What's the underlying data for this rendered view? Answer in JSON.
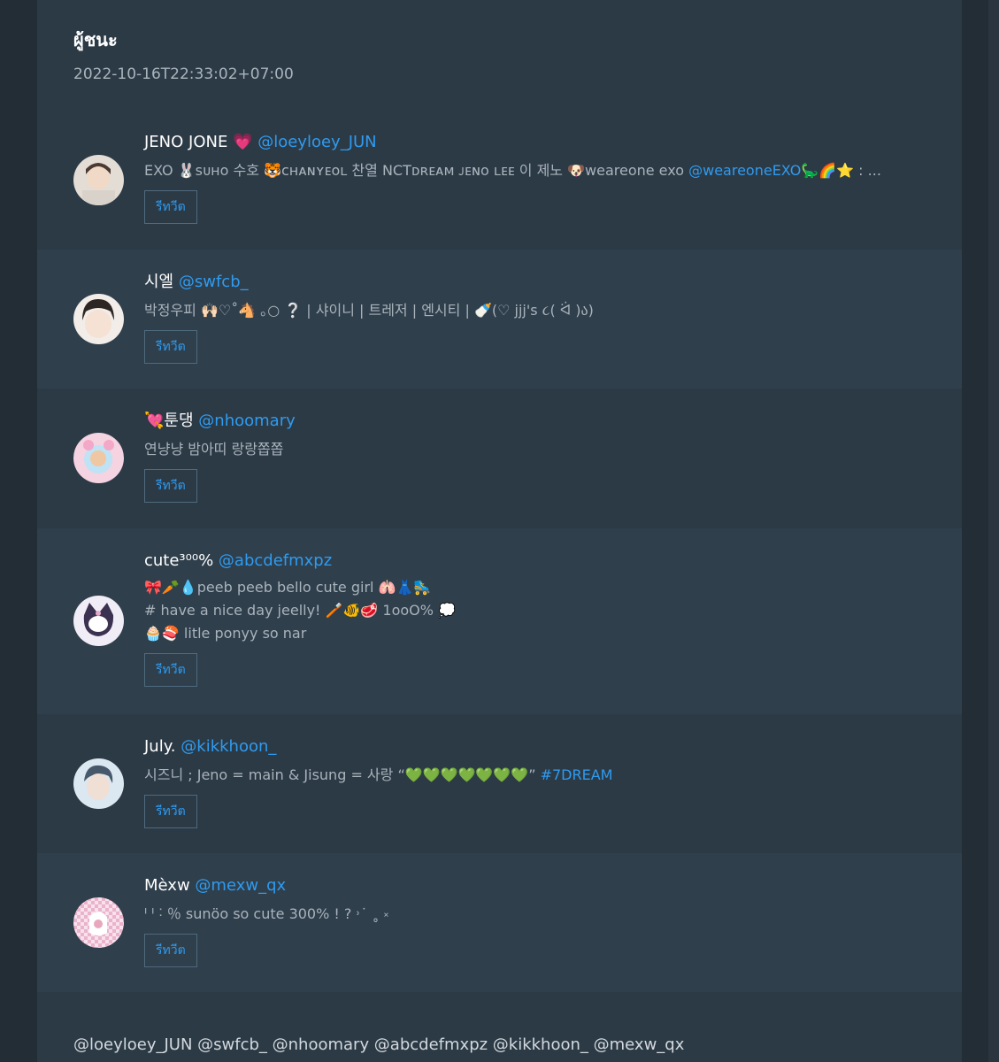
{
  "header": {
    "title": "ผู้ชนะ",
    "timestamp": "2022-10-16T22:33:02+07:00"
  },
  "retweet_label": "รีทวีต",
  "accounts": [
    {
      "name": "JENO JONE 💗",
      "handle": "@loeyloey_JUN",
      "bio_lines": [
        "EXO 🐰ꜱᴜʜᴏ 수호 🐯ᴄʜᴀɴʏᴇᴏʟ 찬열 NCTᴅʀᴇᴀᴍ ᴊᴇɴᴏ ʟᴇᴇ 이 제노 🐶weareone exo "
      ],
      "bio_link": "@weareoneEXO",
      "bio_tail": "🦕🌈⭐ : ...",
      "avatar_colors": [
        "#e6e0d8",
        "#6b5547"
      ]
    },
    {
      "name": "시엘",
      "handle": "@swfcb_",
      "bio_lines": [
        "박정우피 🙌🏻♡˚🐴 ｡○ ❔ | 샤이니 | 트레저 | 엔시티 | 🍼(♡ jjj's ૮( ᐛ )ა)"
      ],
      "avatar_colors": [
        "#f3eee9",
        "#3a2e2a"
      ]
    },
    {
      "name": "💘툰댕",
      "handle": "@nhoomary",
      "bio_lines": [
        "연냥냥 밤아띠 랑랑쫍쫍"
      ],
      "avatar_colors": [
        "#f4c6d8",
        "#b9e0f4"
      ]
    },
    {
      "name": "cute³⁰⁰%",
      "handle": "@abcdefmxpz",
      "bio_lines": [
        "🎀🥕💧peeb peeb bello cute girl 🫁👗🛼",
        "# have a nice day jeelly! 🪥🐠🥩 1ooO% 💭",
        "🧁🍣 litle ponyy so nar"
      ],
      "avatar_colors": [
        "#efeaf6",
        "#6a5a8c"
      ]
    },
    {
      "name": "July.",
      "handle": "@kikkhoon_",
      "bio_lines": [
        "시즈니 ; Jeno = main & Jisung = 사랑 “💚💚💚💚💚💚💚” "
      ],
      "bio_link": "#7DREAM",
      "avatar_colors": [
        "#dfe9f2",
        "#7a8fa8"
      ]
    },
    {
      "name": "Mèxw",
      "handle": "@mexw_qx",
      "bio_lines": [
        "ᑊ ᑊ ˸ ％ sunöo so cute 300% ! ? ˒˙ ˳ ༝"
      ],
      "avatar_colors": [
        "#f6dbe7",
        "#e9a9c4"
      ]
    }
  ],
  "footer_text": "@loeyloey_JUN @swfcb_ @nhoomary @abcdefmxpz @kikkhoon_ @mexw_qx"
}
